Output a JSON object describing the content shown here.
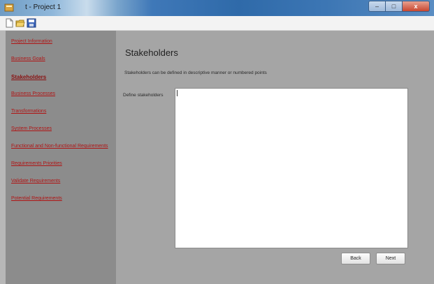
{
  "window": {
    "title": "t - Project 1",
    "min_label": "–",
    "max_label": "□",
    "close_label": "x"
  },
  "toolbar": {
    "icons": [
      "new-document-icon",
      "open-folder-icon",
      "save-icon"
    ]
  },
  "sidebar": {
    "items": [
      {
        "label": "Project Information"
      },
      {
        "label": "Business Goals"
      },
      {
        "label": "Stakeholders",
        "active": true
      },
      {
        "label": "Business Processes"
      },
      {
        "label": "Transformations"
      },
      {
        "label": "System Processes"
      },
      {
        "label": "Functional and Non-functional Requirements"
      },
      {
        "label": "Requirements Priorities"
      },
      {
        "label": "Validate Requirements"
      },
      {
        "label": "Potential Requirements"
      }
    ]
  },
  "main": {
    "title": "Stakeholders",
    "description": "Stakeholders can be defined in descriptive manner or numbered points",
    "field_label": "Define stakeholders",
    "field_value": "",
    "back_label": "Back",
    "next_label": "Next"
  },
  "colors": {
    "sidebar_bg": "#8c8c8c",
    "content_bg": "#a5a5a5",
    "link_color": "#b01414"
  }
}
